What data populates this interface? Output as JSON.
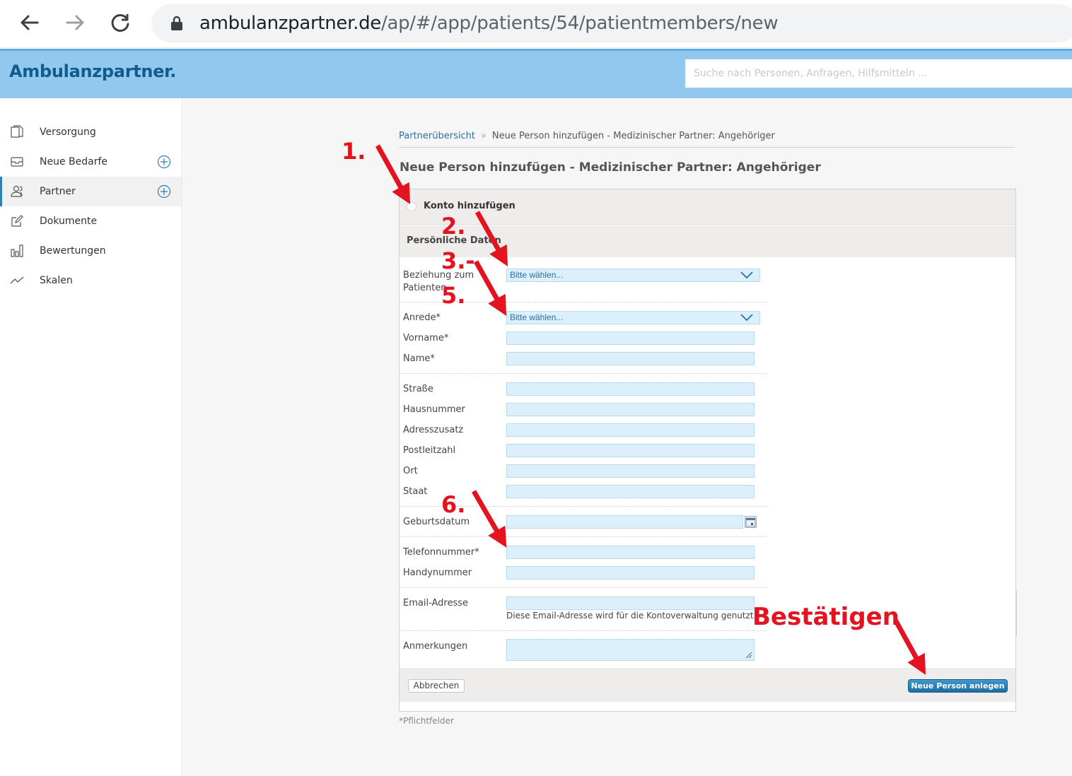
{
  "browser": {
    "url_host": "ambulanzpartner.de",
    "url_path": "/ap/#/app/patients/54/patientmembers/new"
  },
  "header": {
    "logo": "Ambulanzpartner.",
    "search_placeholder": "Suche nach Personen, Anfragen, Hilfsmitteln ..."
  },
  "sidebar": {
    "items": [
      {
        "label": "Versorgung",
        "icon": "document-copy-icon"
      },
      {
        "label": "Neue Bedarfe",
        "icon": "inbox-icon"
      },
      {
        "label": "Partner",
        "icon": "users-icon"
      },
      {
        "label": "Dokumente",
        "icon": "edit-icon"
      },
      {
        "label": "Bewertungen",
        "icon": "bar-chart-icon"
      },
      {
        "label": "Skalen",
        "icon": "trend-icon"
      }
    ]
  },
  "breadcrumb": {
    "link": "Partnerübersicht",
    "separator": "»",
    "current": "Neue Person hinzufügen - Medizinischer Partner: Angehöriger"
  },
  "page_title": "Neue Person hinzufügen - Medizinischer Partner: Angehöriger",
  "form": {
    "konto_label": "Konto hinzufügen",
    "section_label": "Persönliche Daten",
    "beziehung_label": "Beziehung zum\nPatienten",
    "select_placeholder": "Bitte wählen...",
    "labels": {
      "anrede": "Anrede*",
      "vorname": "Vorname*",
      "name": "Name*",
      "strasse": "Straße",
      "hausnummer": "Hausnummer",
      "adresszusatz": "Adresszusatz",
      "postleitzahl": "Postleitzahl",
      "ort": "Ort",
      "staat": "Staat",
      "geburtsdatum": "Geburtsdatum",
      "telefon": "Telefonnummer*",
      "handy": "Handynummer",
      "email": "Email-Adresse",
      "anmerkungen": "Anmerkungen"
    },
    "email_note": "Diese Email-Adresse wird für die Kontoverwaltung genutzt.",
    "cancel_label": "Abbrechen",
    "submit_label": "Neue Person anlegen",
    "required_note": "*Pflichtfelder"
  },
  "annotations": {
    "n1": "1.",
    "n2": "2.",
    "n3": "3.-",
    "n5": "5.",
    "n6": "6.",
    "confirm": "Bestätigen",
    "color": "#e3141f"
  },
  "colors": {
    "header_bg": "#92c8ee",
    "logo": "#0f5d8c",
    "input_bg": "#dcf0fb",
    "primary_button": "#1c6ea3"
  }
}
